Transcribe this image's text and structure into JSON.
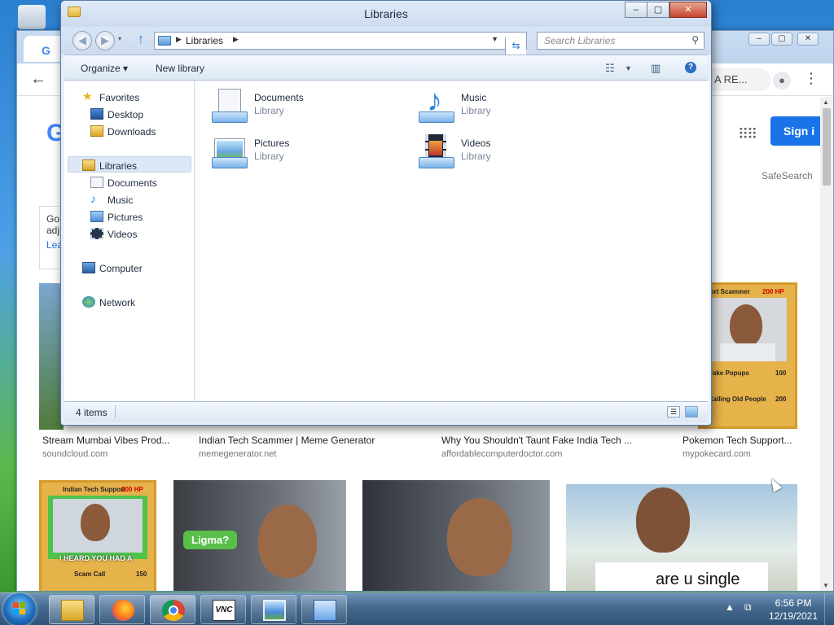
{
  "explorer": {
    "title": "Libraries",
    "address": {
      "segment": "Libraries"
    },
    "search": {
      "placeholder": "Search Libraries"
    },
    "commands": {
      "organize": "Organize ▾",
      "new_library": "New library"
    },
    "nav": {
      "favorites": "Favorites",
      "desktop": "Desktop",
      "downloads": "Downloads",
      "libraries": "Libraries",
      "documents": "Documents",
      "music": "Music",
      "pictures": "Pictures",
      "videos": "Videos",
      "computer": "Computer",
      "network": "Network"
    },
    "items": [
      {
        "name": "Documents",
        "type": "Library"
      },
      {
        "name": "Music",
        "type": "Library"
      },
      {
        "name": "Pictures",
        "type": "Library"
      },
      {
        "name": "Videos",
        "type": "Library"
      }
    ],
    "status": "4 items"
  },
  "chrome": {
    "tab_favicon": "G",
    "account_chip": "A RE...",
    "google_partial": "G",
    "signin": "Sign i",
    "safesearch": "SafeSearch",
    "notice": {
      "line1": "Go",
      "line2": "adj",
      "link": "Lea"
    },
    "results": [
      {
        "caption": "Stream Mumbai Vibes Prod...",
        "source": "soundcloud.com"
      },
      {
        "caption": "Indian Tech Scammer | Meme Generator",
        "source": "memegenerator.net"
      },
      {
        "caption": "Why You Shouldn't Taunt Fake India Tech ...",
        "source": "affordablecomputerdoctor.com"
      },
      {
        "caption": "Pokemon Tech Support...",
        "source": "mypokecard.com"
      }
    ],
    "card1": {
      "title": "pport Scammer",
      "hp": "200 HP",
      "move1": "Fake Popups",
      "move1_dmg": "100",
      "move2": "Calling Old People",
      "move2_dmg": "200"
    },
    "card2": {
      "title": "Indian Tech Support",
      "hp": "200 HP",
      "caption": "I HEARD YOU HAD A",
      "move": "Scam Call",
      "dmg": "150"
    },
    "bubble": "Ligma?",
    "meme_text": "are u single"
  },
  "taskbar": {
    "time": "6:56 PM",
    "date": "12/19/2021"
  },
  "colors": {
    "accent": "#1a73e8",
    "explorer_frame": "#cddcef",
    "taskbar": "#45698e"
  }
}
